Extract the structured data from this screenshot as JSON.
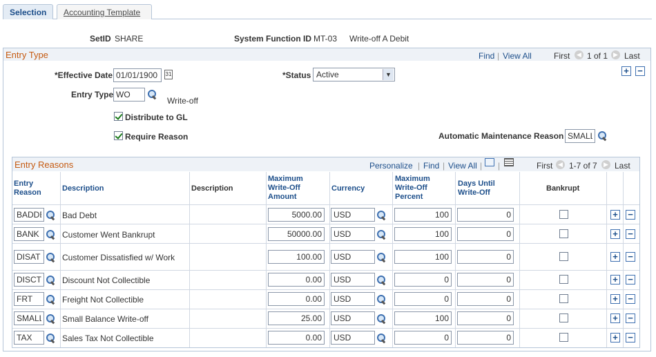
{
  "tabs": {
    "selection": "Selection",
    "accounting_template": "Accounting Template"
  },
  "header": {
    "setid_label": "SetID",
    "setid_value": "SHARE",
    "sysfunc_label": "System Function ID",
    "sysfunc_value": "MT-03",
    "sysfunc_desc": "Write-off A Debit"
  },
  "entry_type": {
    "title": "Entry Type",
    "nav": {
      "find": "Find",
      "sep": "|",
      "view_all": "View All",
      "first": "First",
      "count": "1 of 1",
      "last": "Last"
    },
    "effective_date_label": "*Effective Date",
    "effective_date_value": "01/01/1900",
    "status_label": "*Status",
    "status_value": "Active",
    "entry_type_label": "Entry Type",
    "entry_type_value": "WO",
    "entry_type_desc": "Write-off",
    "distribute_label": "Distribute to GL",
    "distribute_checked": true,
    "require_reason_label": "Require Reason",
    "require_reason_checked": true,
    "auto_maint_label": "Automatic Maintenance Reason",
    "auto_maint_value": "SMALL"
  },
  "entry_reasons": {
    "title": "Entry Reasons",
    "nav": {
      "personalize": "Personalize",
      "find": "Find",
      "view_all": "View All",
      "first": "First",
      "count": "1-7 of 7",
      "last": "Last"
    },
    "columns": {
      "entry_reason": [
        "Entry",
        "Reason"
      ],
      "description1": "Description",
      "description2": "Description",
      "max_amount": [
        "Maximum",
        "Write-Off",
        "Amount"
      ],
      "currency": "Currency",
      "max_percent": [
        "Maximum",
        "Write-Off",
        "Percent"
      ],
      "days": [
        "Days Until",
        "Write-Off"
      ],
      "bankrupt": "Bankrupt"
    },
    "rows": [
      {
        "reason": "BADDB",
        "desc": "Bad Debt",
        "amount": "5000.00",
        "currency": "USD",
        "percent": "100",
        "days": "0",
        "bankrupt": false
      },
      {
        "reason": "BANK",
        "desc": "Customer Went Bankrupt",
        "amount": "50000.00",
        "currency": "USD",
        "percent": "100",
        "days": "0",
        "bankrupt": false
      },
      {
        "reason": "DISAT",
        "desc": "Customer Dissatisfied w/ Work",
        "amount": "100.00",
        "currency": "USD",
        "percent": "100",
        "days": "0",
        "bankrupt": false
      },
      {
        "reason": "DISCT",
        "desc": "Discount Not Collectible",
        "amount": "0.00",
        "currency": "USD",
        "percent": "0",
        "days": "0",
        "bankrupt": false
      },
      {
        "reason": "FRT",
        "desc": "Freight Not Collectible",
        "amount": "0.00",
        "currency": "USD",
        "percent": "0",
        "days": "0",
        "bankrupt": false
      },
      {
        "reason": "SMALL",
        "desc": "Small Balance Write-off",
        "amount": "25.00",
        "currency": "USD",
        "percent": "100",
        "days": "0",
        "bankrupt": false
      },
      {
        "reason": "TAX",
        "desc": "Sales Tax Not Collectible",
        "amount": "0.00",
        "currency": "USD",
        "percent": "0",
        "days": "0",
        "bankrupt": false
      }
    ]
  },
  "icons": {
    "lookup": "magnifier-icon",
    "calendar": "calendar-icon",
    "add": "plus-icon",
    "remove": "minus-icon",
    "prev": "prev-arrow-icon",
    "next": "next-arrow-icon",
    "zoom": "zoom-grid-icon",
    "download": "download-grid-icon"
  },
  "colors": {
    "accent": "#1c4e8a",
    "section_title": "#c55a11",
    "border": "#b5c5d8"
  }
}
